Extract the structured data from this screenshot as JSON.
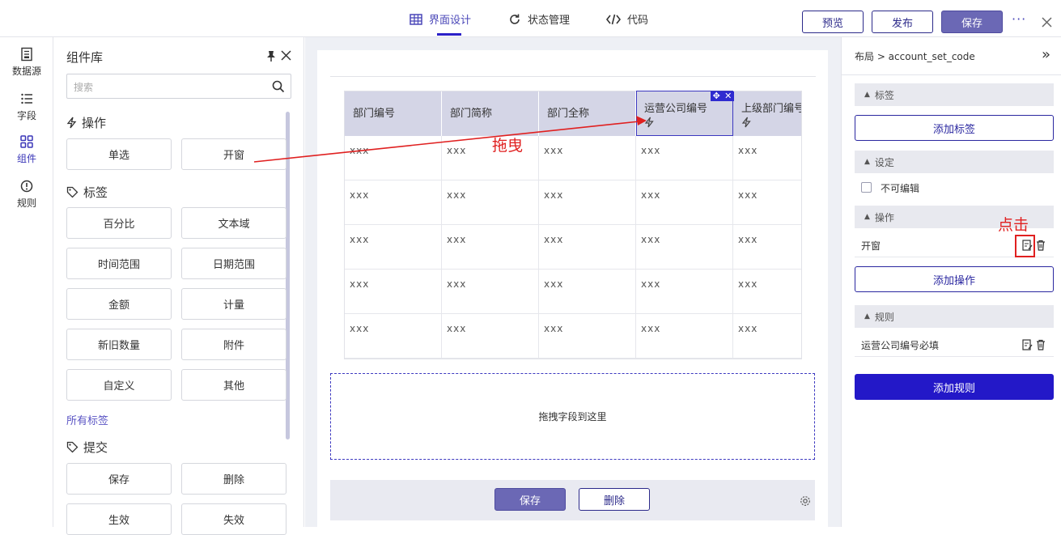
{
  "header": {
    "tabs": [
      {
        "label": "界面设计",
        "icon": "table-icon",
        "active": true
      },
      {
        "label": "状态管理",
        "icon": "refresh-icon",
        "active": false
      },
      {
        "label": "代码",
        "icon": "code-icon",
        "active": false
      }
    ],
    "preview_label": "预览",
    "publish_label": "发布",
    "save_label": "保存",
    "more_icon": "more-icon",
    "close_icon": "close-icon"
  },
  "rail": {
    "items": [
      {
        "label": "数据源",
        "icon": "datasource-icon",
        "active": false
      },
      {
        "label": "字段",
        "icon": "list-icon",
        "active": false
      },
      {
        "label": "组件",
        "icon": "grid-icon",
        "active": true
      },
      {
        "label": "规则",
        "icon": "alert-icon",
        "active": false
      }
    ]
  },
  "library": {
    "title": "组件库",
    "search_placeholder": "搜索",
    "sections": {
      "operations": {
        "title": "操作",
        "items": [
          "单选",
          "开窗"
        ]
      },
      "tags": {
        "title": "标签",
        "items": [
          "百分比",
          "文本域",
          "时间范围",
          "日期范围",
          "金额",
          "计量",
          "新旧数量",
          "附件",
          "自定义",
          "其他"
        ],
        "all_link": "所有标签"
      },
      "submit": {
        "title": "提交",
        "items": [
          "保存",
          "删除",
          "生效",
          "失效"
        ]
      }
    }
  },
  "table": {
    "columns": [
      "部门编号",
      "部门简称",
      "部门全称",
      "运营公司编号",
      "上级部门编号"
    ],
    "rows": [
      [
        "xxx",
        "xxx",
        "xxx",
        "xxx",
        "xxx"
      ],
      [
        "xxx",
        "xxx",
        "xxx",
        "xxx",
        "xxx"
      ],
      [
        "xxx",
        "xxx",
        "xxx",
        "xxx",
        "xxx"
      ],
      [
        "xxx",
        "xxx",
        "xxx",
        "xxx",
        "xxx"
      ],
      [
        "xxx",
        "xxx",
        "xxx",
        "xxx",
        "xxx"
      ]
    ]
  },
  "dropzone_label": "拖拽字段到这里",
  "form_footer": {
    "save_label": "保存",
    "delete_label": "删除"
  },
  "props": {
    "breadcrumb": "布局 > account_set_code",
    "sections": {
      "tags": "标签",
      "settings": "设定",
      "operations": "操作",
      "rules": "规则"
    },
    "add_tag_label": "添加标签",
    "readonly_label": "不可编辑",
    "operation_item": "开窗",
    "add_operation_label": "添加操作",
    "rule_item": "运营公司编号必填",
    "add_rule_label": "添加规则"
  },
  "annotations": {
    "drag_label": "拖曳",
    "click_label": "点击",
    "arrow_color": "#e02020"
  },
  "colors": {
    "accent": "#2b21c8",
    "header_fill": "#d4d5e6",
    "primary_button": "#6b68b5"
  }
}
